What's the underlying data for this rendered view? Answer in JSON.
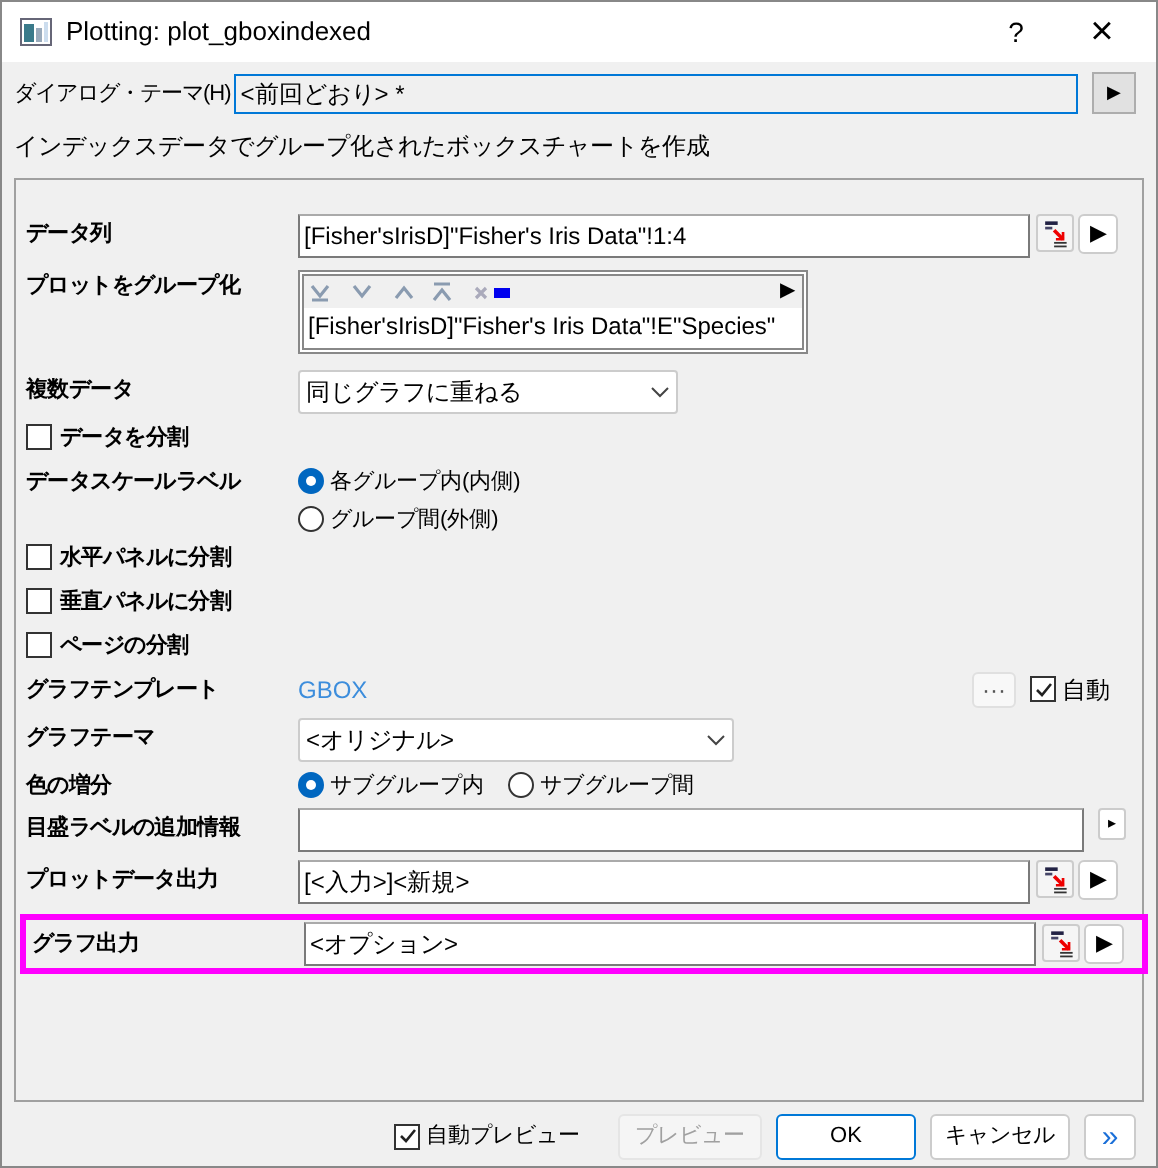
{
  "window": {
    "title": "Plotting: plot_gboxindexed",
    "help": "?",
    "close": "×"
  },
  "theme": {
    "label": "ダイアログ・テーマ(H)",
    "value": "<前回どおり> *",
    "arrow": "▶"
  },
  "description": "インデックスデータでグループ化されたボックスチャートを作成",
  "rows": [
    {
      "kind": "field",
      "label": "データ列",
      "value": "[Fisher'sIrisD]\"Fisher's Iris Data\"!1:4",
      "picker": true,
      "arrow": "▶",
      "highlighted": false
    },
    {
      "kind": "group_list",
      "label": "プロットをグループ化",
      "value": "[Fisher'sIrisD]\"Fisher's Iris Data\"!E\"Species\"",
      "arrow": "▶"
    },
    {
      "kind": "dropdown",
      "label": "複数データ",
      "value": "同じグラフに重ねる",
      "wide": false
    },
    {
      "kind": "checkbox",
      "label": "データを分割",
      "checked": false
    },
    {
      "kind": "radio",
      "label": "データスケールラベル",
      "vertical": true,
      "options": [
        {
          "label": "各グループ内(内側)",
          "selected": true
        },
        {
          "label": "グループ間(外側)",
          "selected": false
        }
      ]
    },
    {
      "kind": "checkbox",
      "label": "水平パネルに分割",
      "checked": false
    },
    {
      "kind": "checkbox",
      "label": "垂直パネルに分割",
      "checked": false
    },
    {
      "kind": "checkbox",
      "label": "ページの分割",
      "checked": false
    },
    {
      "kind": "template",
      "label": "グラフテンプレート",
      "value": "GBOX",
      "more": "···",
      "auto": {
        "label": "自動",
        "checked": true
      }
    },
    {
      "kind": "dropdown",
      "label": "グラフテーマ",
      "value": "<オリジナル>",
      "wide": true
    },
    {
      "kind": "radio",
      "label": "色の増分",
      "vertical": false,
      "options": [
        {
          "label": "サブグループ内",
          "selected": true
        },
        {
          "label": "サブグループ間",
          "selected": false
        }
      ]
    },
    {
      "kind": "field",
      "label": "目盛ラベルの追加情報",
      "picker": false,
      "arrow": "▸",
      "highlighted": false
    },
    {
      "kind": "field",
      "label": "プロットデータ出力",
      "value": "[<入力>]<新規>",
      "picker": true,
      "arrow": "▶",
      "highlighted": false
    },
    {
      "kind": "field",
      "label": "グラフ出力",
      "value": "<オプション>",
      "picker": true,
      "arrow": "▶",
      "highlighted": true
    }
  ],
  "footer": {
    "auto_preview": {
      "label": "自動プレビュー",
      "checked": true
    },
    "buttons": [
      {
        "label": "プレビュー",
        "disabled": true,
        "default": false
      },
      {
        "label": "OK",
        "disabled": false,
        "default": true
      },
      {
        "label": "キャンセル",
        "disabled": false,
        "default": false
      }
    ],
    "expand": "»"
  }
}
